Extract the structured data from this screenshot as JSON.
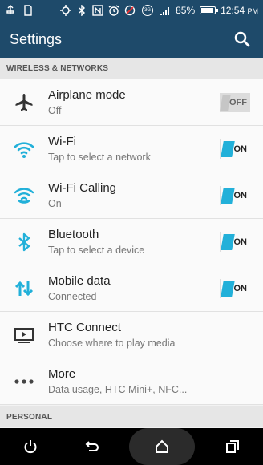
{
  "status_bar": {
    "battery_percent": "85%",
    "time": "12:54",
    "time_suffix": "PM",
    "network_type": "3G",
    "icons": [
      "usb-icon",
      "sim-card-icon",
      "gps-icon",
      "bluetooth-icon",
      "nfc-icon",
      "alarm-icon",
      "data-saver-icon",
      "network-type-icon",
      "signal-icon",
      "battery-icon"
    ]
  },
  "app_bar": {
    "title": "Settings",
    "search_icon": "search-icon"
  },
  "sections": {
    "wireless": "WIRELESS & NETWORKS",
    "personal": "PERSONAL"
  },
  "items": [
    {
      "title": "Airplane mode",
      "subtitle": "Off",
      "icon": "airplane-icon",
      "toggle": "OFF"
    },
    {
      "title": "Wi-Fi",
      "subtitle": "Tap to select a network",
      "icon": "wifi-icon",
      "toggle": "ON"
    },
    {
      "title": "Wi-Fi Calling",
      "subtitle": "On",
      "icon": "wifi-calling-icon",
      "toggle": "ON"
    },
    {
      "title": "Bluetooth",
      "subtitle": "Tap to select a device",
      "icon": "bluetooth-icon",
      "toggle": "ON"
    },
    {
      "title": "Mobile data",
      "subtitle": "Connected",
      "icon": "mobile-data-icon",
      "toggle": "ON"
    },
    {
      "title": "HTC Connect",
      "subtitle": "Choose where to play media",
      "icon": "htc-connect-icon"
    },
    {
      "title": "More",
      "subtitle": "Data usage, HTC Mini+, NFC...",
      "icon": "more-icon"
    }
  ],
  "nav_bar": {
    "buttons": [
      "power-icon",
      "back-icon",
      "home-icon",
      "recents-icon"
    ]
  },
  "colors": {
    "app_bar": "#1e4a6a",
    "accent": "#22b0d9",
    "section_bg": "#e6e6e6"
  }
}
